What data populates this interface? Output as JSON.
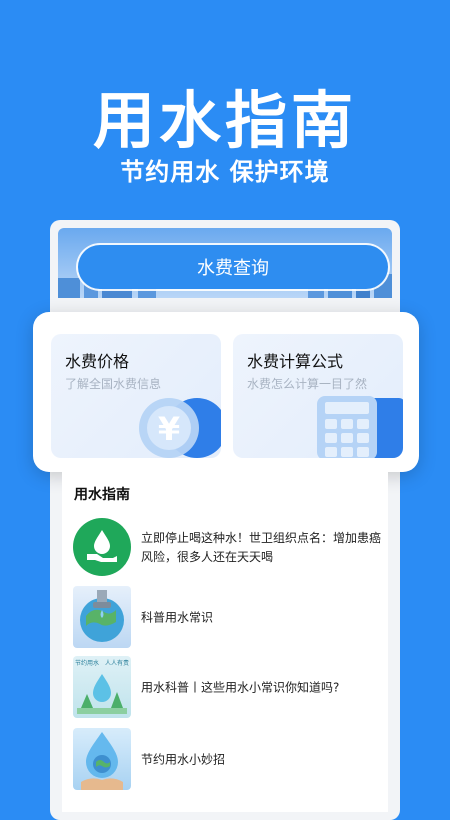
{
  "hero": {
    "title": "用水指南",
    "subtitle": "节约用水 保护环境"
  },
  "query_button": "水费查询",
  "cards": [
    {
      "title": "水费价格",
      "desc": "了解全国水费信息",
      "icon": "yen-coin-icon"
    },
    {
      "title": "水费计算公式",
      "desc": "水费怎么计算一目了然",
      "icon": "calculator-icon"
    }
  ],
  "guide": {
    "title": "用水指南",
    "items": [
      {
        "text": "立即停止喝这种水！世卫组织点名：增加患癌风险，很多人还在天天喝",
        "thumb": "hand-water-drop-icon"
      },
      {
        "text": "科普用水常识",
        "thumb": "earth-faucet-image"
      },
      {
        "text": "用水科普丨这些用水小常识你知道吗?",
        "thumb": "save-water-poster",
        "thumb_caption": "节约用水　人人有责"
      },
      {
        "text": "节约用水小妙招",
        "thumb": "water-drop-earth-image"
      }
    ]
  },
  "colors": {
    "background": "#2b8cf4",
    "accent": "#2e8df0",
    "green": "#1fa85a"
  }
}
